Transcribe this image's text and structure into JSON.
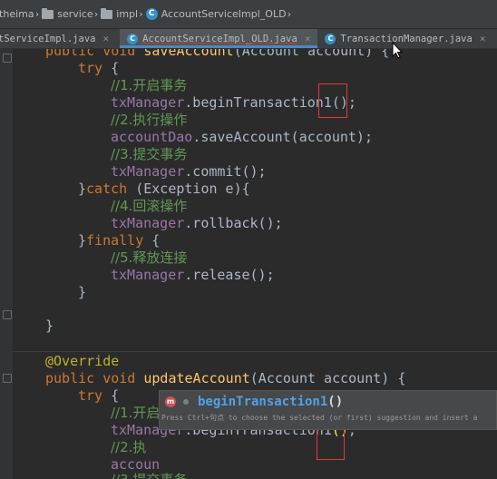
{
  "breadcrumb": {
    "items": [
      {
        "label": "itheima",
        "icon": "folder-icon"
      },
      {
        "label": "service",
        "icon": "folder-icon"
      },
      {
        "label": "impl",
        "icon": "folder-icon"
      },
      {
        "label": "AccountServiceImpl_OLD",
        "icon": "class-icon"
      }
    ],
    "class_icon_letter": "C"
  },
  "tabs": [
    {
      "label": "tServiceImpl.java",
      "active": false
    },
    {
      "label": "AccountServiceImpl_OLD.java",
      "active": true
    },
    {
      "label": "TransactionManager.java",
      "active": false
    }
  ],
  "tab_close_glyph": "×",
  "code": {
    "l1_public": "public",
    "l1_void": "void",
    "l1_method": "saveAccount",
    "l1_rest": "(Account account) {",
    "try": "try",
    "try_brace": " {",
    "c1": "//1.开启事务",
    "tx1_field": "txManager",
    "tx1_call": ".beginTransaction1();",
    "c2": "//2.执行操作",
    "dao_field": "accountDao",
    "dao_call": ".saveAccount(account);",
    "c3": "//3.提交事务",
    "tx3_field": "txManager",
    "tx3_call": ".commit();",
    "catch_open": "}",
    "catch_kw": "catch",
    "catch_rest": " (Exception e){",
    "c4": "//4.回滚操作",
    "tx4_field": "txManager",
    "tx4_call": ".rollback();",
    "finally_open": "}",
    "finally_kw": "finally",
    "finally_rest": " {",
    "c5": "//5.释放连接",
    "tx5_field": "txManager",
    "tx5_call": ".release();",
    "close_inner": "}",
    "close_method": "}",
    "annotation": "@Override",
    "l2_public": "public",
    "l2_void": "void",
    "l2_method": "updateAccount",
    "l2_rest": "(Account account) {",
    "try2": "try",
    "try2_brace": " {",
    "c6": "//1.开启事务",
    "tx6_field": "txManager",
    "tx6_call_a": ".beginTransaction1",
    "tx6_paren": "()",
    "tx6_semi": ";",
    "c7": "//2.执",
    "acc_partial": "accoun",
    "c8_partial": "//3.提交事务"
  },
  "autocomplete": {
    "icon_letter": "m",
    "suggestion_match": "beginTransaction1",
    "suggestion_rest": "()",
    "hint": "Press Ctrl+句点 to choose the selected (or first) suggestion and insert a"
  },
  "colors": {
    "background": "#2b2b2b",
    "keyword": "#cc7832",
    "comment": "#629755",
    "field": "#9876aa",
    "method_decl": "#ffc66d",
    "annotation": "#bbb529",
    "highlight_box": "#e03a3a"
  }
}
